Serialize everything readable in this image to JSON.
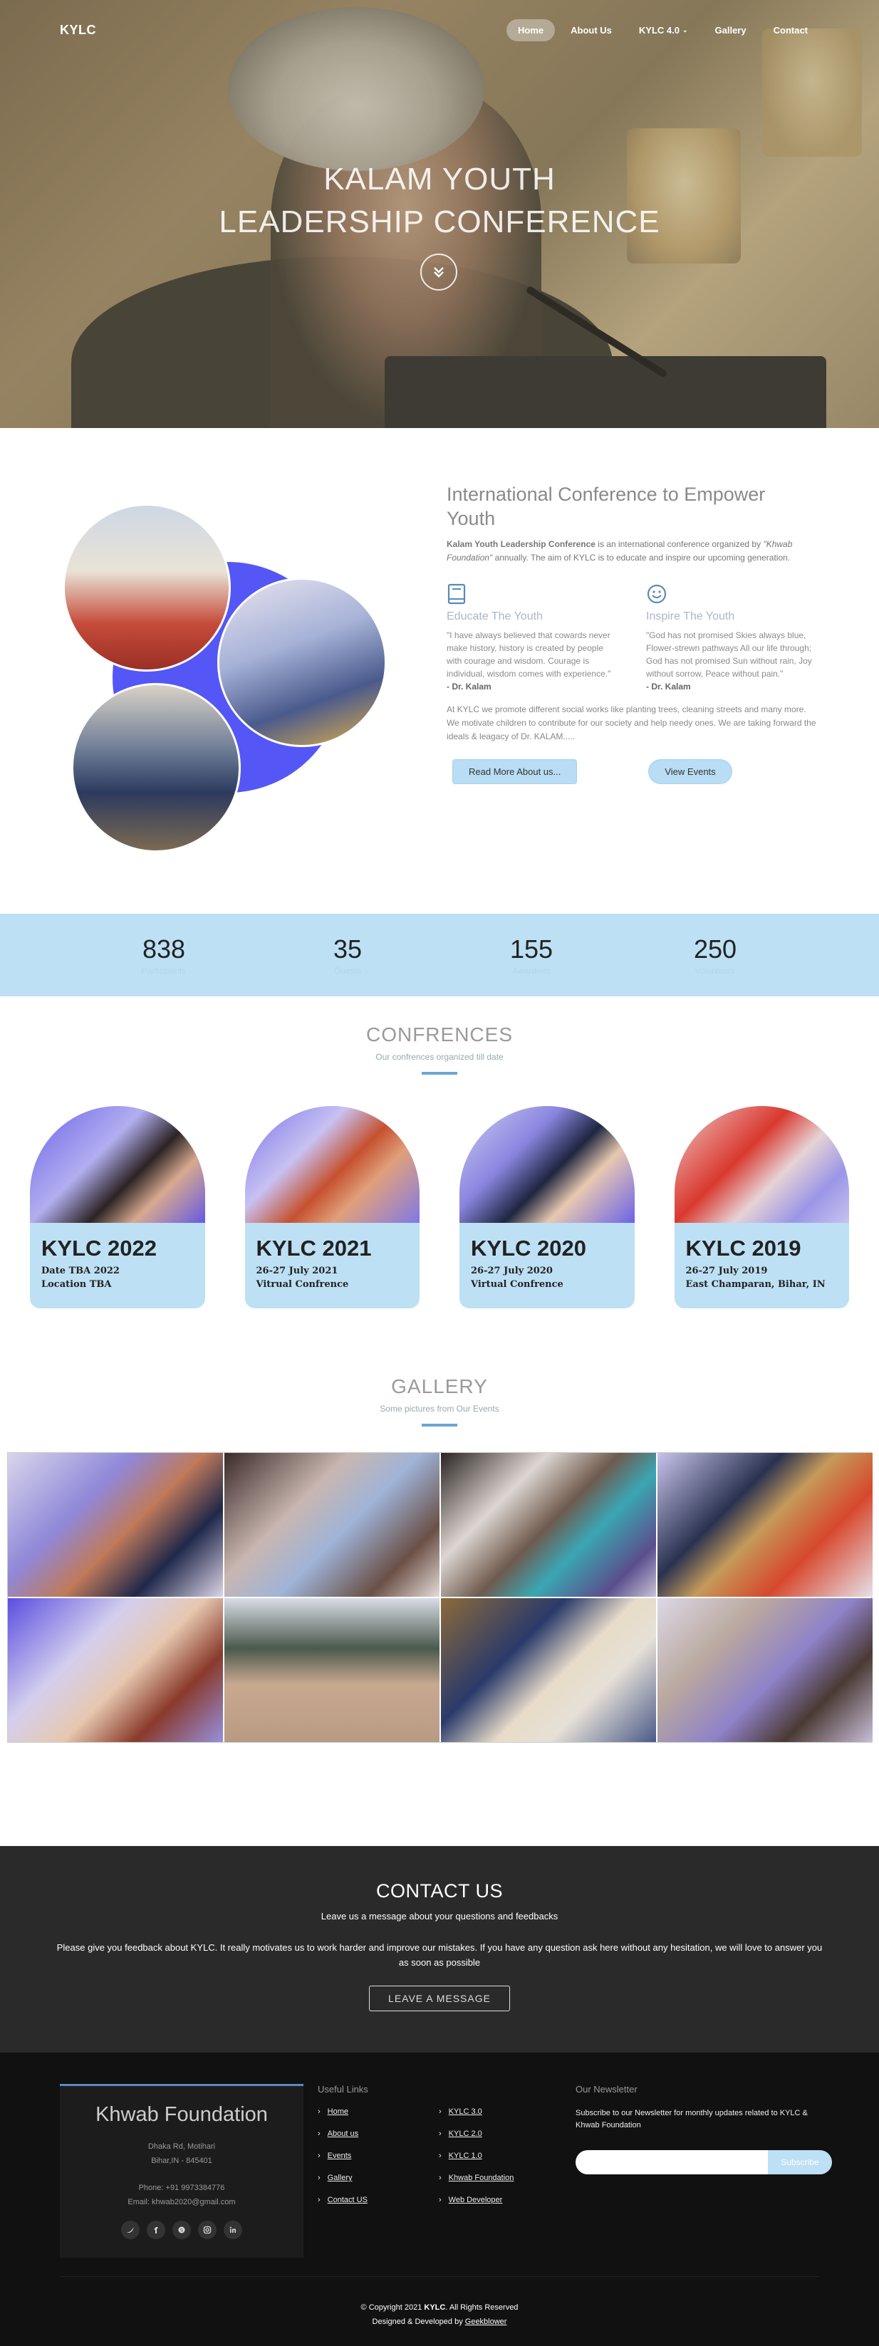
{
  "nav": {
    "brand": "KYLC",
    "items": [
      {
        "label": "Home",
        "active": true
      },
      {
        "label": "About Us"
      },
      {
        "label": "KYLC 4.0",
        "has_dropdown": true
      },
      {
        "label": "Gallery"
      },
      {
        "label": "Contact"
      }
    ]
  },
  "hero": {
    "title_line1": "KALAM YOUTH",
    "title_line2": "LEADERSHIP CONFERENCE",
    "down_icon": "double-chevron-down-icon"
  },
  "about": {
    "heading": "International Conference to Empower Youth",
    "lead_bold": "Kalam Youth Leadership Conference",
    "lead_text": " is an international conference organized by ",
    "lead_org": "\"Khwab Foundation\"",
    "lead_rest": " annually. The aim of KYLC is to educate and inspire our upcoming generation.",
    "features": [
      {
        "icon": "book-icon",
        "title": "Educate The Youth",
        "quote": "\"I have always believed that cowards never make history, history is created by people with courage and wisdom. Courage is individual, wisdom comes with experience.\"",
        "author": "- Dr. Kalam"
      },
      {
        "icon": "smile-icon",
        "title": "Inspire The Youth",
        "quote": "\"God has not promised Skies always blue, Flower-strewn pathways All our life through; God has not promised Sun without rain, Joy without sorrow, Peace without pain.\"",
        "author": "- Dr. Kalam"
      }
    ],
    "paragraph": "At KYLC we promote different social works like planting trees, cleaning streets and many more. We motivate children to contribute for our society and help needy ones. We are taking forward the ideals & leagacy of Dr. KALAM.....",
    "btn_more": "Read More About us...",
    "btn_events": "View Events"
  },
  "stats": [
    {
      "num": "838",
      "label": "Participants"
    },
    {
      "num": "35",
      "label": "Guests"
    },
    {
      "num": "155",
      "label": "Awardees"
    },
    {
      "num": "250",
      "label": "Volunteers"
    }
  ],
  "conferences": {
    "title": "CONFRENCES",
    "subtitle": "Our confrences organized till date",
    "cards": [
      {
        "title": "KYLC 2022",
        "date": "Date TBA 2022",
        "location": "Location TBA"
      },
      {
        "title": "KYLC 2021",
        "date": "26-27 July 2021",
        "location": "Vitrual Confrence"
      },
      {
        "title": "KYLC 2020",
        "date": "26-27 July 2020",
        "location": "Virtual Confrence"
      },
      {
        "title": "KYLC 2019",
        "date": "26-27 July 2019",
        "location": "East Champaran, Bihar, IN"
      }
    ]
  },
  "gallery": {
    "title": "GALLERY",
    "subtitle": "Some pictures from Our Events"
  },
  "contact": {
    "title": "CONTACT US",
    "subtitle": "Leave us a message about your questions and feedbacks",
    "desc": "Please give you feedback about KYLC. It really motivates us to work harder and improve our mistakes. If you have any question ask here without any hesitation, we will love to answer you as soon as possible",
    "button": "LEAVE A MESSAGE"
  },
  "footer": {
    "org": "Khwab Foundation",
    "addr1": "Dhaka Rd, Motihari",
    "addr2": "Bihar,IN - 845401",
    "phone": "Phone: +91 9973384776",
    "email": "Email: khwab2020@gmail.com",
    "socials": [
      "twitter-icon",
      "facebook-icon",
      "skype-icon",
      "instagram-icon",
      "linkedin-icon"
    ],
    "links_title": "Useful Links",
    "links_col1": [
      "Home",
      "About us",
      "Events",
      "Gallery",
      "Contact US"
    ],
    "links_col2": [
      "KYLC 3.0",
      "KYLC 2.0",
      "KYLC 1.0",
      "Khwab Foundation",
      "Web Developer"
    ],
    "news_title": "Our Newsletter",
    "news_text": "Subscribe to our Newsletter for monthly updates related to KYLC & Khwab Foundation",
    "news_input_placeholder": "",
    "news_button": "Subscribe",
    "copyright_pre": "© Copyright 2021 ",
    "copyright_bold": "KYLC",
    "copyright_post": ". All Rights Reserved",
    "dev_pre": "Designed & Developed by ",
    "dev_link": "Geekblower"
  }
}
